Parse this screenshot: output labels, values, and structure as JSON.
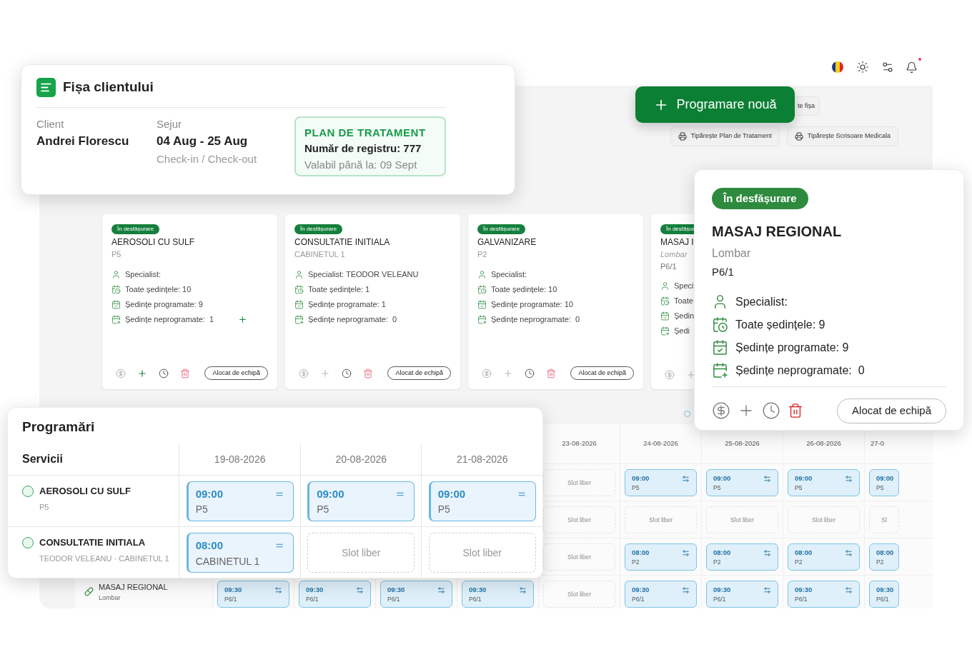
{
  "toolbar": {
    "partial_button": "te fișa",
    "print_buttons": [
      "Tipărește Plan de Tratament",
      "Tipărește Scrisoare Medicala"
    ]
  },
  "service_cards": [
    {
      "status": "În desfășurare",
      "title": "AEROSOLI CU SULF",
      "subtitle": "P5",
      "can_add": true,
      "lines": [
        {
          "kind": "specialist",
          "text": "Specialist:"
        },
        {
          "kind": "total",
          "text": "Toate ședințele: 10"
        },
        {
          "kind": "scheduled",
          "text": "Ședințe programate: 9"
        },
        {
          "kind": "unscheduled",
          "text": "Ședințe neprogramate:  1"
        }
      ],
      "assign": "Alocat de echipă"
    },
    {
      "status": "În desfășurare",
      "title": "CONSULTATIE INITIALA",
      "subtitle": "CABINETUL 1",
      "can_add": false,
      "lines": [
        {
          "kind": "specialist",
          "text": "Specialist: TEODOR VELEANU"
        },
        {
          "kind": "total",
          "text": "Toate ședințele: 1"
        },
        {
          "kind": "scheduled",
          "text": "Ședințe programate: 1"
        },
        {
          "kind": "unscheduled",
          "text": "Ședințe neprogramate:  0"
        }
      ],
      "assign": "Alocat de echipă"
    },
    {
      "status": "În desfășurare",
      "title": "GALVANIZARE",
      "subtitle": "P2",
      "can_add": false,
      "lines": [
        {
          "kind": "specialist",
          "text": "Specialist:"
        },
        {
          "kind": "total",
          "text": "Toate ședințele: 10"
        },
        {
          "kind": "scheduled",
          "text": "Ședințe programate: 10"
        },
        {
          "kind": "unscheduled",
          "text": "Ședințe neprogramate:  0"
        }
      ],
      "assign": "Alocat de echipă"
    },
    {
      "status": "În desfășur",
      "title": "MASAJ I",
      "subtitle": "Lombar",
      "room": "P6/1",
      "can_add": false,
      "lines": [
        {
          "kind": "specialist",
          "text": "Speci"
        },
        {
          "kind": "total",
          "text": "Toate"
        },
        {
          "kind": "scheduled",
          "text": "Ședin"
        },
        {
          "kind": "unscheduled",
          "text": "Ședi"
        }
      ]
    }
  ],
  "schedule": {
    "columns": [
      null,
      null,
      null,
      null,
      {
        "date": "23-08-2026",
        "cut": false
      },
      {
        "date": "24-08-2026",
        "cut": false
      },
      {
        "date": "25-08-2026",
        "cut": false
      },
      {
        "date": "26-08-2026",
        "cut": false
      },
      {
        "date": "27-0",
        "cut": true
      }
    ],
    "rows": [
      {
        "cells": [
          "",
          "",
          "",
          "",
          {
            "kind": "free",
            "label": "Slot liber"
          },
          {
            "kind": "slot",
            "time": "09:00",
            "room": "P5"
          },
          {
            "kind": "slot",
            "time": "09:00",
            "room": "P5"
          },
          {
            "kind": "slot",
            "time": "09:00",
            "room": "P5"
          },
          {
            "kind": "slot",
            "time": "09:00",
            "room": "P5"
          }
        ]
      },
      {
        "cells": [
          "",
          "",
          "",
          "",
          {
            "kind": "free",
            "label": "Slot liber"
          },
          {
            "kind": "free",
            "label": "Slot liber"
          },
          {
            "kind": "free",
            "label": "Slot liber"
          },
          {
            "kind": "free",
            "label": "Slot liber"
          },
          {
            "kind": "free",
            "label": "Sl"
          }
        ]
      },
      {
        "cells": [
          "",
          "",
          "",
          "",
          {
            "kind": "free",
            "label": "Slot liber"
          },
          {
            "kind": "slot",
            "time": "08:00",
            "room": "P2"
          },
          {
            "kind": "slot",
            "time": "08:00",
            "room": "P2"
          },
          {
            "kind": "slot",
            "time": "08:00",
            "room": "P2"
          },
          {
            "kind": "slot",
            "time": "08:00",
            "room": "P2"
          }
        ]
      },
      {
        "name": "MASAJ REGIONAL",
        "detail": "Lombar",
        "cells": [
          {
            "kind": "slot",
            "time": "09:30",
            "room": "P6/1"
          },
          {
            "kind": "slot",
            "time": "09:30",
            "room": "P6/1"
          },
          {
            "kind": "slot",
            "time": "09:30",
            "room": "P6/1"
          },
          {
            "kind": "slot",
            "time": "09:30",
            "room": "P6/1"
          },
          {
            "kind": "free",
            "label": "Slot liber"
          },
          {
            "kind": "slot",
            "time": "09:30",
            "room": "P6/1"
          },
          {
            "kind": "slot",
            "time": "09:30",
            "room": "P6/1"
          },
          {
            "kind": "slot",
            "time": "09:30",
            "room": "P6/1"
          },
          {
            "kind": "slot",
            "time": "09:30",
            "room": "P6/1"
          }
        ]
      }
    ]
  },
  "client_sheet": {
    "title": "Fișa clientului",
    "fields": [
      {
        "label": "Client",
        "value": "Andrei Florescu"
      },
      {
        "label": "Sejur",
        "value": "04 Aug - 25 Aug",
        "note": "Check-in / Check-out"
      }
    ],
    "plan": {
      "title": "PLAN DE TRATAMENT",
      "register": "Număr de registru: 777",
      "valid": "Valabil până la: 09 Sept"
    }
  },
  "new_appointment_button": "Programare nouă",
  "service_popup": {
    "status": "În desfășurare",
    "title": "MASAJ REGIONAL",
    "subtitle": "Lombar",
    "room": "P6/1",
    "can_add": false,
    "lines": [
      {
        "kind": "specialist",
        "text": "Specialist:"
      },
      {
        "kind": "total",
        "text": "Toate ședințele: 9"
      },
      {
        "kind": "scheduled",
        "text": "Ședințe programate: 9"
      },
      {
        "kind": "unscheduled",
        "text": "Ședințe neprogramate:  0"
      }
    ],
    "assign": "Alocat de echipă"
  },
  "appointments_popup": {
    "title": "Programări",
    "services_header": "Servicii",
    "dates": [
      "19-08-2026",
      "20-08-2026",
      "21-08-2026"
    ],
    "rows": [
      {
        "name": "AEROSOLI CU SULF",
        "detail": "P5",
        "cells": [
          {
            "kind": "slot",
            "time": "09:00",
            "room": "P5"
          },
          {
            "kind": "slot",
            "time": "09:00",
            "room": "P5"
          },
          {
            "kind": "slot",
            "time": "09:00",
            "room": "P5"
          }
        ]
      },
      {
        "name": "CONSULTATIE INITIALA",
        "detail": "TEODOR VELEANU · CABINETUL 1",
        "cells": [
          {
            "kind": "slot",
            "time": "08:00",
            "room": "CABINETUL 1"
          },
          {
            "kind": "free",
            "label": "Slot liber"
          },
          {
            "kind": "free",
            "label": "Slot liber"
          }
        ]
      }
    ]
  }
}
